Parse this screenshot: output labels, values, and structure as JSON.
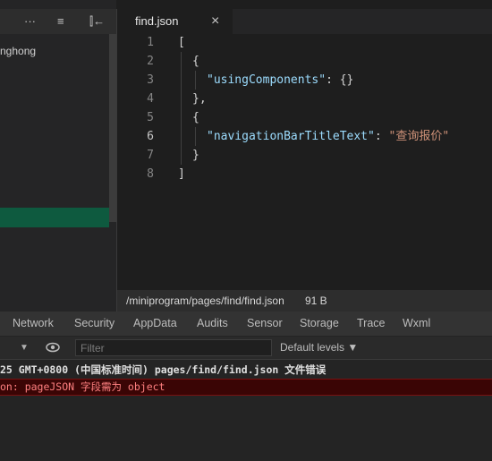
{
  "sidebar": {
    "toolbar_icons": [
      "more-icon",
      "collapse-list-icon",
      "split-panel-icon"
    ],
    "toolbar_glyphs": [
      "···",
      "≡",
      "⫿←"
    ],
    "project_name": "nghong"
  },
  "editor": {
    "tab": {
      "label": "find.json",
      "close_glyph": "×"
    },
    "line_numbers": [
      "1",
      "2",
      "3",
      "4",
      "5",
      "6",
      "7",
      "8"
    ],
    "active_line": 6,
    "code": {
      "l1": "[",
      "l2": "{",
      "l3_key": "\"usingComponents\"",
      "l3_rest": ": {}",
      "l4": "},",
      "l5": "{",
      "l6_key": "\"navigationBarTitleText\"",
      "l6_colon": ": ",
      "l6_value": "\"查询报价\"",
      "l7": "}",
      "l8": "]"
    },
    "status": {
      "path": "/miniprogram/pages/find/find.json",
      "size": "91 B"
    }
  },
  "devtools": {
    "tabs": [
      "Network",
      "Security",
      "AppData",
      "Audits",
      "Sensor",
      "Storage",
      "Trace",
      "Wxml"
    ],
    "filter_placeholder": "Filter",
    "levels_label": "Default levels ▼",
    "dropdown_caret": "▼",
    "log_info": "25 GMT+0800 (中国标准时间)  pages/find/find.json 文件错误",
    "log_error": "on: pageJSON 字段需为 object"
  },
  "colors": {
    "accent_selected": "#0e5a3f",
    "json_key": "#9cdcfe",
    "json_string": "#ce9178",
    "error_text": "#ff8080"
  }
}
